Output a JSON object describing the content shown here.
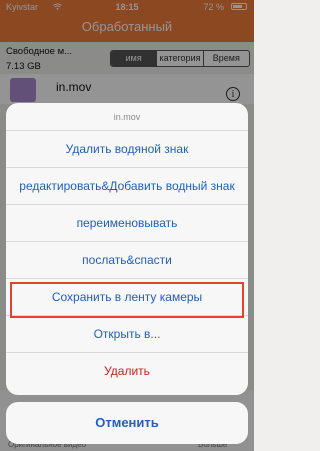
{
  "status": {
    "carrier": "Kyivstar",
    "time": "18:15",
    "battery": "72 %"
  },
  "header": {
    "title": "Обработанный"
  },
  "storage": {
    "label": "Свободное м...",
    "size": "7.13 GB"
  },
  "sort_tabs": [
    "имя",
    "категория",
    "Время"
  ],
  "file": {
    "name": "in.mov"
  },
  "bottom_bar": {
    "left_label": "Оригинальное видео",
    "right_label": "Вольше"
  },
  "action_sheet": {
    "title": "in.mov",
    "items": [
      "Удалить водяной знак",
      "редактировать&Добавить водный знак",
      "переименовывать",
      "послать&спасти",
      "Сохранить в ленту камеры",
      "Открыть в...",
      "Удалить"
    ],
    "cancel": "Отменить"
  },
  "colors": {
    "header": "#f07c3a",
    "action_text": "#1f5fbf",
    "destructive": "#d01f1f",
    "highlight_border": "#e2452b"
  }
}
